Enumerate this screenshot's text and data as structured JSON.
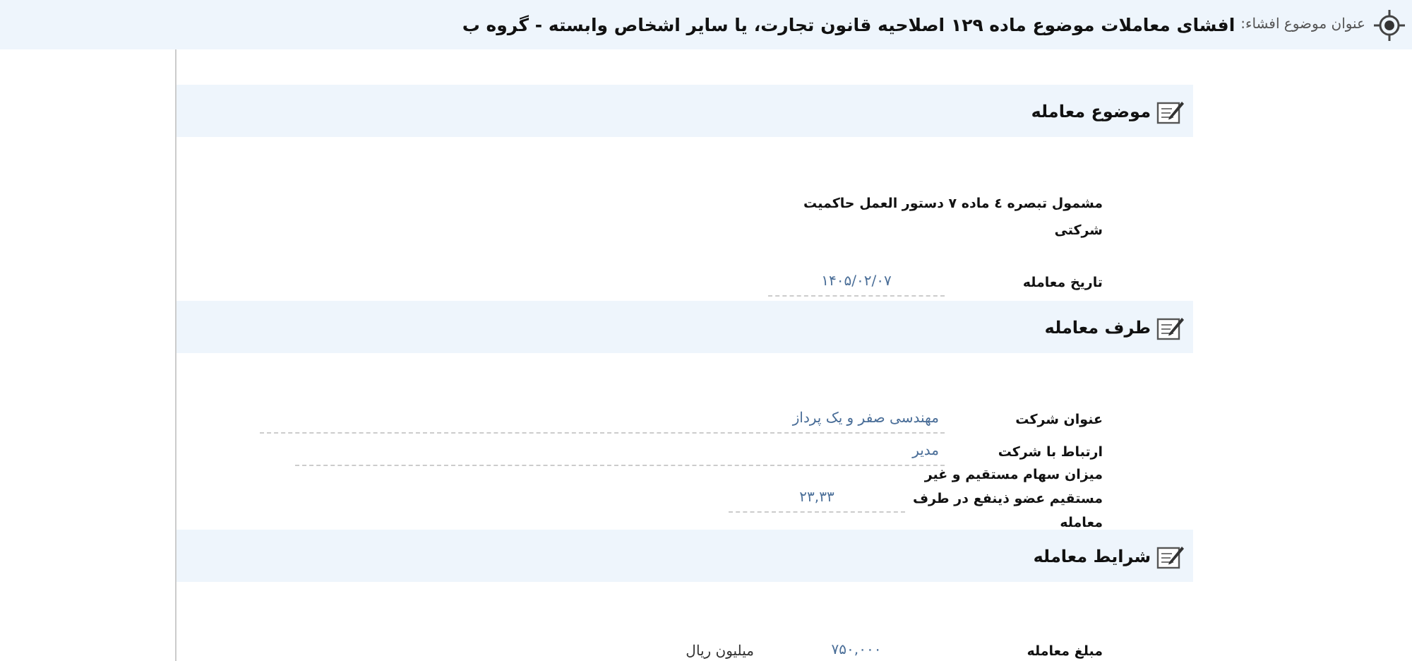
{
  "header": {
    "label": "عنوان موضوع افشاء:",
    "title": "افشای معاملات موضوع ماده ۱۲۹ اصلاحیه قانون تجارت، یا سایر اشخاص وابسته - گروه ب"
  },
  "sections": [
    {
      "title": "موضوع معامله",
      "rows": [
        {
          "kind": "note",
          "text": "مشمول تبصره ٤ ماده ۷ دستور العمل حاکمیت شرکتی"
        },
        {
          "kind": "field",
          "label": "تاریخ معامله",
          "value": "۱۴۰۵/۰۲/۰۷"
        }
      ]
    },
    {
      "title": "طرف معامله",
      "rows": [
        {
          "kind": "field",
          "label": "عنوان شرکت",
          "value": "مهندسی صفر و یک پرداز"
        },
        {
          "kind": "field",
          "label": "ارتباط با شرکت",
          "value": "مدیر"
        },
        {
          "kind": "field",
          "label": "میزان سهام مستقیم و غیر مستقیم عضو ذینفع در طرف معامله",
          "value": "۲۳,۳۳"
        }
      ]
    },
    {
      "title": "شرایط معامله",
      "rows": [
        {
          "kind": "field",
          "label": "مبلغ معامله",
          "value": "۷۵۰,۰۰۰",
          "unit": "میلیون ریال"
        }
      ]
    }
  ]
}
